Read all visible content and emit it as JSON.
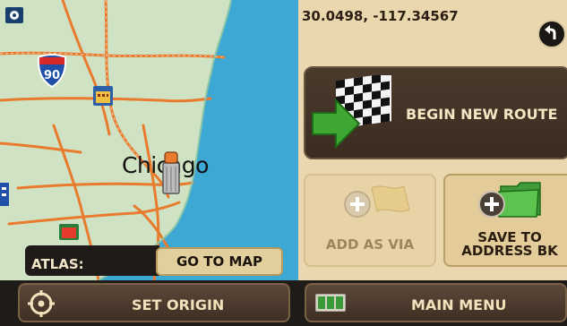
{
  "map": {
    "city": "Chicago",
    "highway_shield": "90",
    "atlas_label": "ATLAS:",
    "goto_button": "GO TO MAP"
  },
  "panel": {
    "coordinates": "30.0498, -117.34567",
    "begin_route": "BEGIN NEW ROUTE",
    "add_via": "ADD AS VIA",
    "save_to": "SAVE TO",
    "address_bk": "ADDRESS BK"
  },
  "bottom": {
    "set_origin": "SET ORIGIN",
    "main_menu": "MAIN MENU"
  },
  "icons": {
    "back": "back-arrow-icon",
    "begin_route": "checkered-flag-arrow-icon",
    "add_via": "add-via-flag-icon",
    "save": "folder-add-icon",
    "origin": "crosshair-icon",
    "menu": "keyboard-icon"
  },
  "colors": {
    "water": "#3ea8d4",
    "land": "#cfe3c4",
    "road": "#e87b2e",
    "panel_bg": "#ead7ad",
    "button_dark": "#3a2c20",
    "arrow_green": "#3fa832"
  }
}
